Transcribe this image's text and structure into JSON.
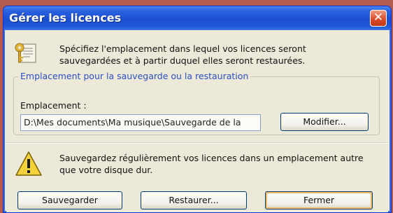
{
  "window": {
    "title": "Gérer les licences",
    "close_glyph": "✕"
  },
  "intro": {
    "icon": "key-document-icon",
    "text": "Spécifiez l'emplacement dans lequel vos licences seront sauvegardées et à partir duquel elles seront restaurées."
  },
  "location_group": {
    "legend": "Emplacement pour la sauvegarde ou la restauration",
    "label": "Emplacement :",
    "value": "D:\\Mes documents\\Ma musique\\Sauvegarde de la",
    "modify_label": "Modifier..."
  },
  "warning": {
    "icon": "warning-icon",
    "text": "Sauvegardez régulièrement vos licences dans un emplacement autre que votre disque dur."
  },
  "buttons": {
    "save_label": "Sauvegarder",
    "restore_label": "Restaurer...",
    "close_label": "Fermer"
  },
  "colors": {
    "titlebar": "#1c4fd0",
    "legend_text": "#2a4fc4",
    "close_button": "#d84a26"
  }
}
